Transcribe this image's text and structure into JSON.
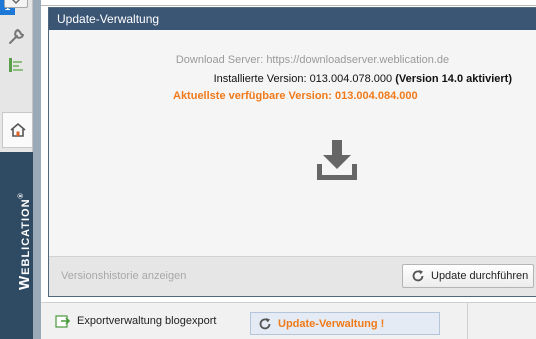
{
  "sidebar": {
    "badge_count": "1",
    "brand": "Weblication",
    "brand_mark": "®"
  },
  "dialog": {
    "title": "Update-Verwaltung",
    "server_line": "Download Server: https://downloadserver.weblication.de",
    "installed_label": "Installierte Version:",
    "installed_version": "013.004.078.000",
    "installed_note": "(Version 14.0 aktiviert)",
    "latest_label": "Aktuellste verfügbare Version:",
    "latest_version": "013.004.084.000",
    "history_link": "Versionshistorie anzeigen",
    "update_button": "Update durchführen"
  },
  "taskbar": {
    "items": [
      {
        "label": "Exportverwaltung blogexport"
      },
      {
        "label": "Update-Verwaltung !"
      }
    ]
  },
  "colors": {
    "accent_orange": "#f07a1a",
    "title_bar": "#3b5675",
    "brand_bar": "#2f4a63",
    "badge_blue": "#1e78d8"
  }
}
